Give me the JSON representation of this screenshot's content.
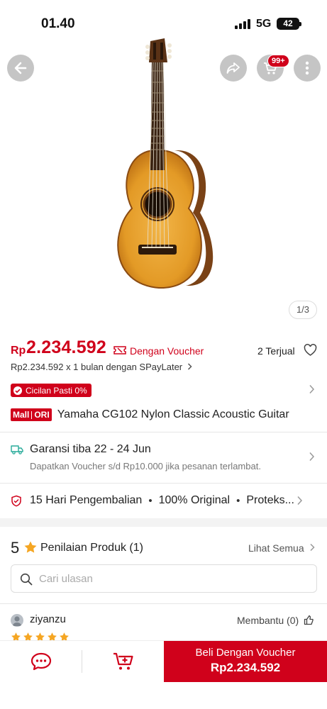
{
  "status_bar": {
    "time": "01.40",
    "network": "5G",
    "battery": "42"
  },
  "header": {
    "cart_badge": "99+"
  },
  "gallery": {
    "counter": "1/3"
  },
  "price": {
    "currency": "Rp",
    "amount": "2.234.592",
    "voucher_label": "Dengan Voucher",
    "sold": "2 Terjual",
    "spaylater": "Rp2.234.592 x 1 bulan dengan SPayLater"
  },
  "promo": {
    "cicilan": "Cicilan Pasti 0%"
  },
  "product": {
    "mall_label": "Mall",
    "ori_label": "ORI",
    "title": "Yamaha CG102 Nylon Classic Acoustic Guitar"
  },
  "shipping": {
    "title": "Garansi tiba 22 - 24 Jun",
    "subtitle": "Dapatkan Voucher s/d Rp10.000 jika pesanan terlambat."
  },
  "guarantees": [
    "15 Hari Pengembalian",
    "100% Original",
    "Proteks..."
  ],
  "reviews": {
    "rating": "5",
    "title": "Penilaian Produk",
    "count": "(1)",
    "see_all": "Lihat Semua",
    "search_placeholder": "Cari ulasan",
    "items": [
      {
        "name": "ziyanzu",
        "helpful": "Membantu (0)",
        "stars": 5
      }
    ]
  },
  "bottom_bar": {
    "buy_label": "Beli Dengan Voucher",
    "buy_price": "Rp2.234.592"
  },
  "colors": {
    "accent": "#d0011b",
    "star": "#f5a623"
  }
}
